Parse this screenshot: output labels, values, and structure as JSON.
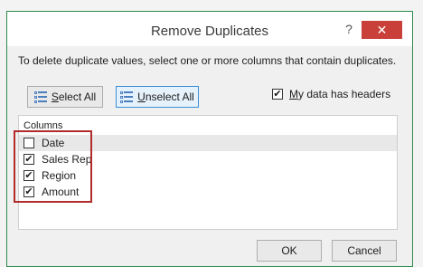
{
  "dialog": {
    "title": "Remove Duplicates",
    "help_label": "?",
    "close_label": "✕"
  },
  "instructions": "To delete duplicate values, select one or more columns that contain duplicates.",
  "buttons": {
    "select_all_underlined": "S",
    "select_all_rest": "elect All",
    "unselect_all_underlined": "U",
    "unselect_all_rest": "nselect All",
    "ok": "OK",
    "cancel": "Cancel"
  },
  "headers_option": {
    "checked": true,
    "underlined": "M",
    "rest": "y data has headers"
  },
  "columns": {
    "heading": "Columns",
    "items": [
      {
        "label": "Date",
        "checked": false,
        "selected": true
      },
      {
        "label": "Sales Rep",
        "checked": true,
        "selected": false
      },
      {
        "label": "Region",
        "checked": true,
        "selected": false
      },
      {
        "label": "Amount",
        "checked": true,
        "selected": false
      }
    ]
  },
  "colors": {
    "border_green": "#2f8a4c",
    "close_red": "#c9403a",
    "highlight_red": "#b22b2b",
    "focus_blue": "#3b8fd9"
  }
}
